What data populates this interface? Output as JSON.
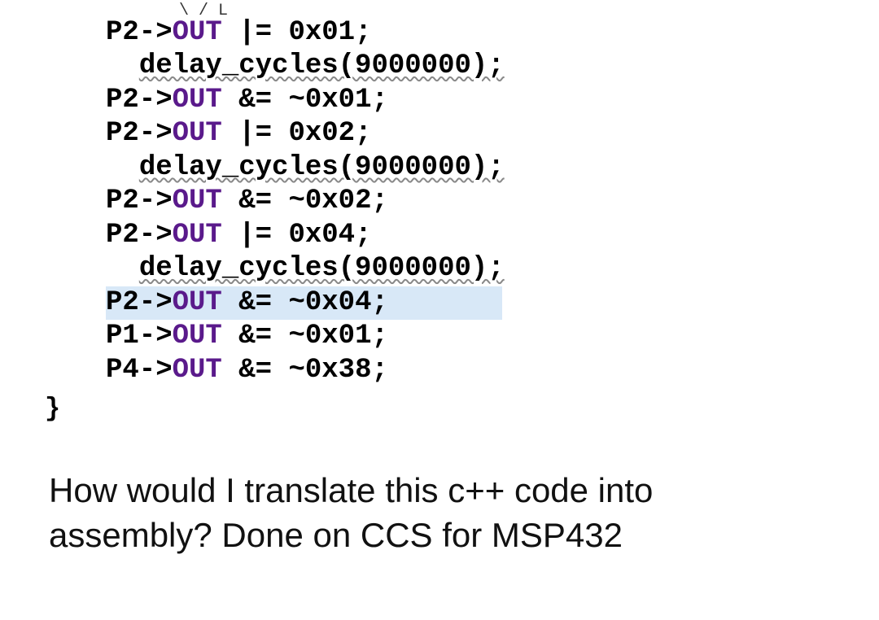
{
  "code": {
    "prefix": "....",
    "lines": [
      {
        "type": "port",
        "port": "P2",
        "field": "OUT",
        "text_before": "P2->",
        "text_after": " |= 0x01;"
      },
      {
        "type": "delay",
        "func": "delay_cycles",
        "arg": "9000000"
      },
      {
        "type": "port",
        "port": "P2",
        "field": "OUT",
        "text_before": "P2->",
        "text_after": " &= ~0x01;"
      },
      {
        "type": "port",
        "port": "P2",
        "field": "OUT",
        "text_before": "P2->",
        "text_after": " |= 0x02;"
      },
      {
        "type": "delay",
        "func": "delay_cycles",
        "arg": "9000000"
      },
      {
        "type": "port",
        "port": "P2",
        "field": "OUT",
        "text_before": "P2->",
        "text_after": " &= ~0x02;"
      },
      {
        "type": "port",
        "port": "P2",
        "field": "OUT",
        "text_before": "P2->",
        "text_after": " |= 0x04;"
      },
      {
        "type": "delay",
        "func": "delay_cycles",
        "arg": "9000000"
      },
      {
        "type": "port",
        "port": "P2",
        "field": "OUT",
        "text_before": "P2->",
        "text_after": " &= ~0x04;",
        "highlighted": true
      },
      {
        "type": "port",
        "port": "P1",
        "field": "OUT",
        "text_before": "P1->",
        "text_after": " &= ~0x01;"
      },
      {
        "type": "port",
        "port": "P4",
        "field": "OUT",
        "text_before": "P4->",
        "text_after": " &= ~0x38;"
      }
    ],
    "brace": "}"
  },
  "cursor_mark": "\\ / L",
  "question_line1": "How would I translate this c++ code into",
  "question_line2": "assembly? Done on CCS for MSP432"
}
